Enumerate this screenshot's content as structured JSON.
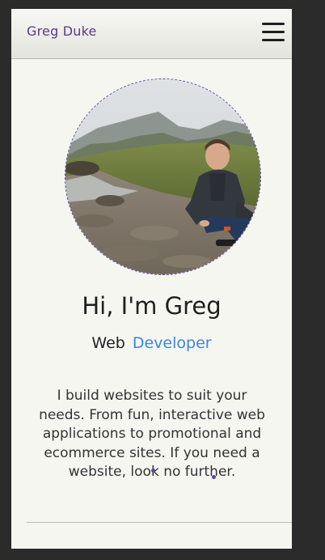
{
  "navbar": {
    "brand": "Greg Duke",
    "menu_icon": "hamburger-menu-icon"
  },
  "hero": {
    "avatar_alt": "Greg crouching by a rocky stream in the mountains",
    "greeting": "Hi, I'm Greg",
    "role_prefix": "Web",
    "role_highlight": "Developer",
    "bio": "I build websites to suit your needs. From fun, interactive web applications to promotional and ecommerce sites. If you need a website, look no further."
  },
  "colors": {
    "brand": "#5a3a8a",
    "accent": "#3d86d9",
    "avatar_border": "#5b46a0",
    "background": "#f6f6f1"
  }
}
